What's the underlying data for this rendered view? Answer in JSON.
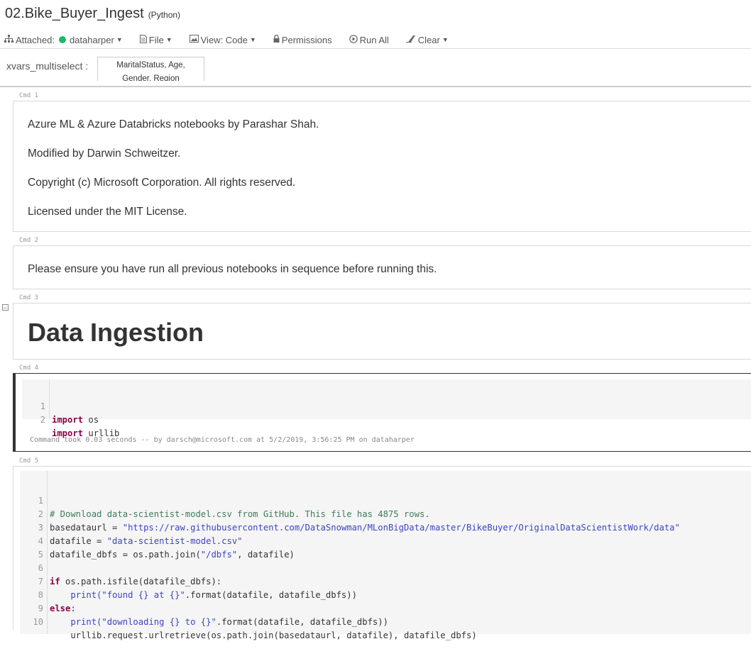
{
  "notebook": {
    "name": "02.Bike_Buyer_Ingest",
    "language": "(Python)"
  },
  "toolbar": {
    "attached_label": "Attached:",
    "cluster": "dataharper",
    "file": "File",
    "view": "View: Code",
    "permissions": "Permissions",
    "run_all": "Run All",
    "clear": "Clear"
  },
  "widget": {
    "label": "xvars_multiselect :",
    "value_line1": "MaritalStatus, Age,",
    "value_line2": "Gender, Region"
  },
  "cells": {
    "cmd1": {
      "label": "Cmd 1",
      "lines": [
        "Azure ML & Azure Databricks notebooks by Parashar Shah.",
        "Modified by Darwin Schweitzer.",
        "Copyright (c) Microsoft Corporation. All rights reserved.",
        "Licensed under the MIT License."
      ]
    },
    "cmd2": {
      "label": "Cmd 2",
      "text": "Please ensure you have run all previous notebooks in sequence before running this."
    },
    "cmd3": {
      "label": "Cmd 3",
      "heading": "Data Ingestion"
    },
    "cmd4": {
      "label": "Cmd 4",
      "footer": "Command took 0.03 seconds -- by darsch@microsoft.com at 5/2/2019, 3:56:25 PM on dataharper"
    },
    "cmd5": {
      "label": "Cmd 5"
    }
  },
  "code": {
    "cmd4": [
      {
        "n": "1",
        "kw": "import",
        "rest": " os"
      },
      {
        "n": "2",
        "kw": "import",
        "rest": " urllib"
      }
    ],
    "cmd5": {
      "l1": {
        "n": "1",
        "comment": "# Download data-scientist-model.csv from GitHub. This file has 4875 rows."
      },
      "l2": {
        "n": "2",
        "lhs": "basedataurl = ",
        "str": "\"https://raw.githubusercontent.com/DataSnowman/MLonBigData/master/BikeBuyer/OriginalDataScientistWork/data\""
      },
      "l3": {
        "n": "3",
        "lhs": "datafile = ",
        "str": "\"data-scientist-model.csv\""
      },
      "l4": {
        "n": "4",
        "lhs": "datafile_dbfs = os.path.join(",
        "str": "\"/dbfs\"",
        "rhs": ", datafile)"
      },
      "l5": {
        "n": "5"
      },
      "l6": {
        "n": "6",
        "kw": "if",
        "rest": " os.path.isfile(datafile_dbfs):"
      },
      "l7": {
        "n": "7",
        "indent": "    ",
        "fn": "print",
        "str": "(\"found {} at {}\"",
        "rest": ".format(datafile, datafile_dbfs))"
      },
      "l8": {
        "n": "8",
        "kw": "else",
        "rest": ":"
      },
      "l9": {
        "n": "9",
        "indent": "    ",
        "fn": "print",
        "str": "(\"downloading {} to {}\"",
        "rest": ".format(datafile, datafile_dbfs))"
      },
      "l10": {
        "n": "10",
        "rest": "    urllib.request.urlretrieve(os.path.join(basedataurl, datafile), datafile_dbfs)"
      }
    }
  },
  "colors": {
    "keyword": "#8b0046",
    "string": "#3c44c4",
    "comment": "#3c7d5c",
    "attached_dot": "#1eb86b"
  }
}
